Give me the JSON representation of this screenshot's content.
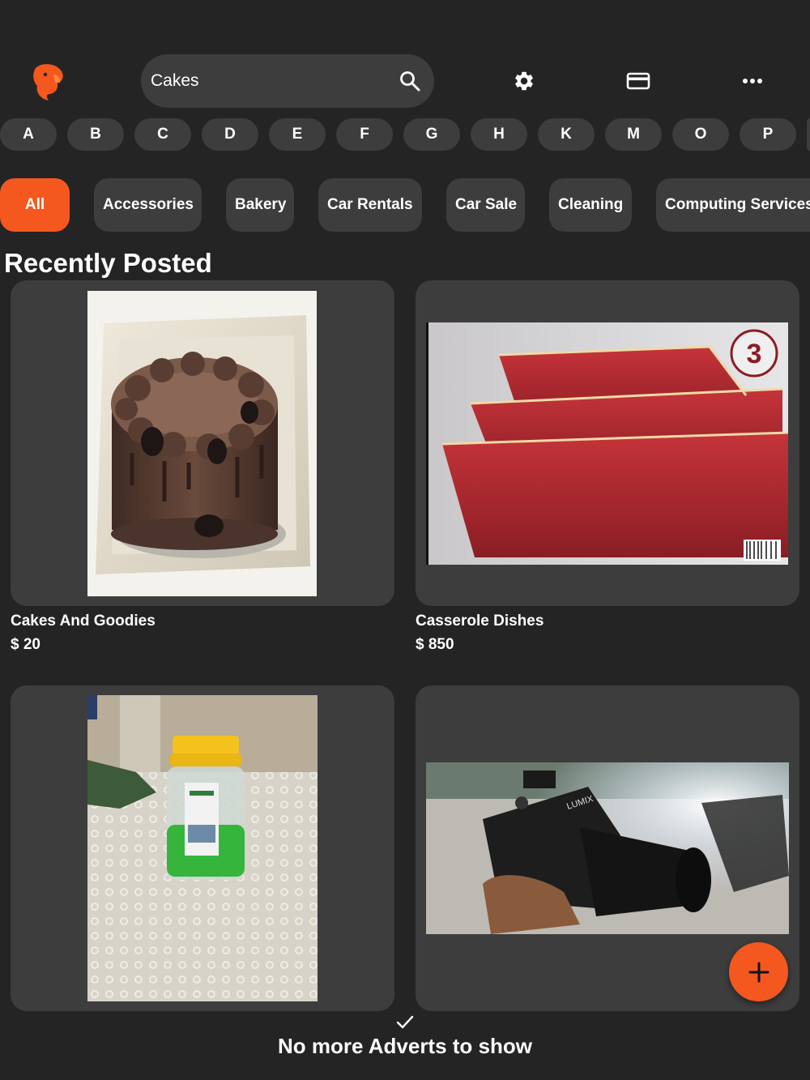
{
  "search": {
    "value": "Cakes"
  },
  "letters": [
    "A",
    "B",
    "C",
    "D",
    "E",
    "F",
    "G",
    "H",
    "K",
    "M",
    "O",
    "P"
  ],
  "categories": [
    "All",
    "Accessories",
    "Bakery",
    "Car Rentals",
    "Car Sale",
    "Cleaning",
    "Computing Services"
  ],
  "section_title": "Recently Posted",
  "listings": [
    {
      "title": "Cakes And Goodies",
      "price": "$ 20"
    },
    {
      "title": "Casserole Dishes",
      "price": "$ 850"
    },
    {
      "title": "",
      "price": ""
    },
    {
      "title": "",
      "price": ""
    }
  ],
  "footer_text": "No more Adverts to show",
  "icons": {
    "logo": "parrot-logo-icon",
    "search": "search-icon",
    "settings": "gear-icon",
    "payment": "credit-card-icon",
    "more": "more-horizontal-icon",
    "add": "plus-icon",
    "done": "checkmark-icon"
  },
  "colors": {
    "background": "#242424",
    "surface": "#3d3d3d",
    "accent": "#f4581f",
    "text": "#ffffff"
  }
}
